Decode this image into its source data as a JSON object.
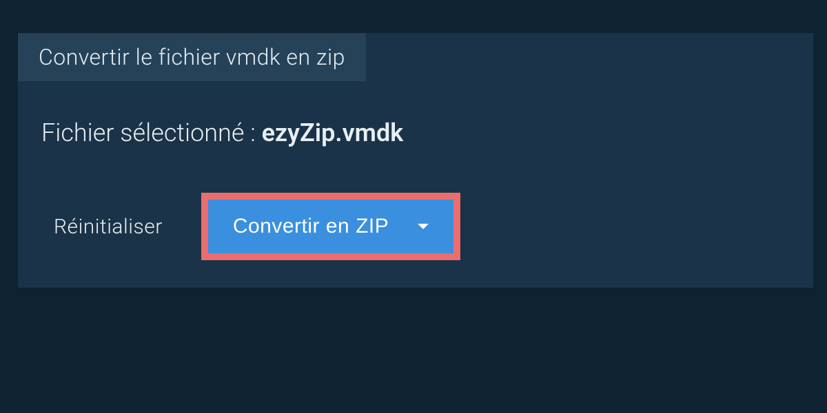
{
  "tab": {
    "title": "Convertir le fichier vmdk en zip"
  },
  "file": {
    "label_prefix": "Fichier sélectionné : ",
    "name": "ezyZip.vmdk"
  },
  "actions": {
    "reset_label": "Réinitialiser",
    "convert_label": "Convertir en ZIP"
  }
}
